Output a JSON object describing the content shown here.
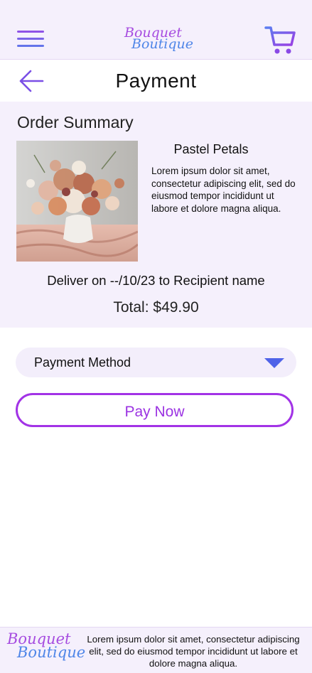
{
  "brand": {
    "line1": "Bouquet",
    "line2": "Boutique"
  },
  "header": {
    "menu_icon": "hamburger-menu-icon",
    "cart_icon": "shopping-cart-icon"
  },
  "titlebar": {
    "back_icon": "arrow-left-icon",
    "title": "Payment"
  },
  "summary": {
    "heading": "Order Summary",
    "product_name": "Pastel Petals",
    "product_description": "Lorem ipsum dolor sit amet, consectetur adipiscing elit, sed do eiusmod tempor incididunt ut labore et dolore magna aliqua.",
    "delivery_text": "Deliver on --/10/23 to Recipient name",
    "total_text": "Total: $49.90"
  },
  "payment": {
    "method_label": "Payment Method",
    "caret_icon": "caret-down-icon",
    "pay_label": "Pay Now"
  },
  "footer": {
    "text": "Lorem ipsum dolor sit amet, consectetur adipiscing elit, sed do eiusmod tempor incididunt ut labore et dolore magna aliqua."
  },
  "colors": {
    "accent_purple": "#a233e6",
    "accent_blue": "#4f86e8",
    "panel_lavender": "#f5f0fc"
  }
}
